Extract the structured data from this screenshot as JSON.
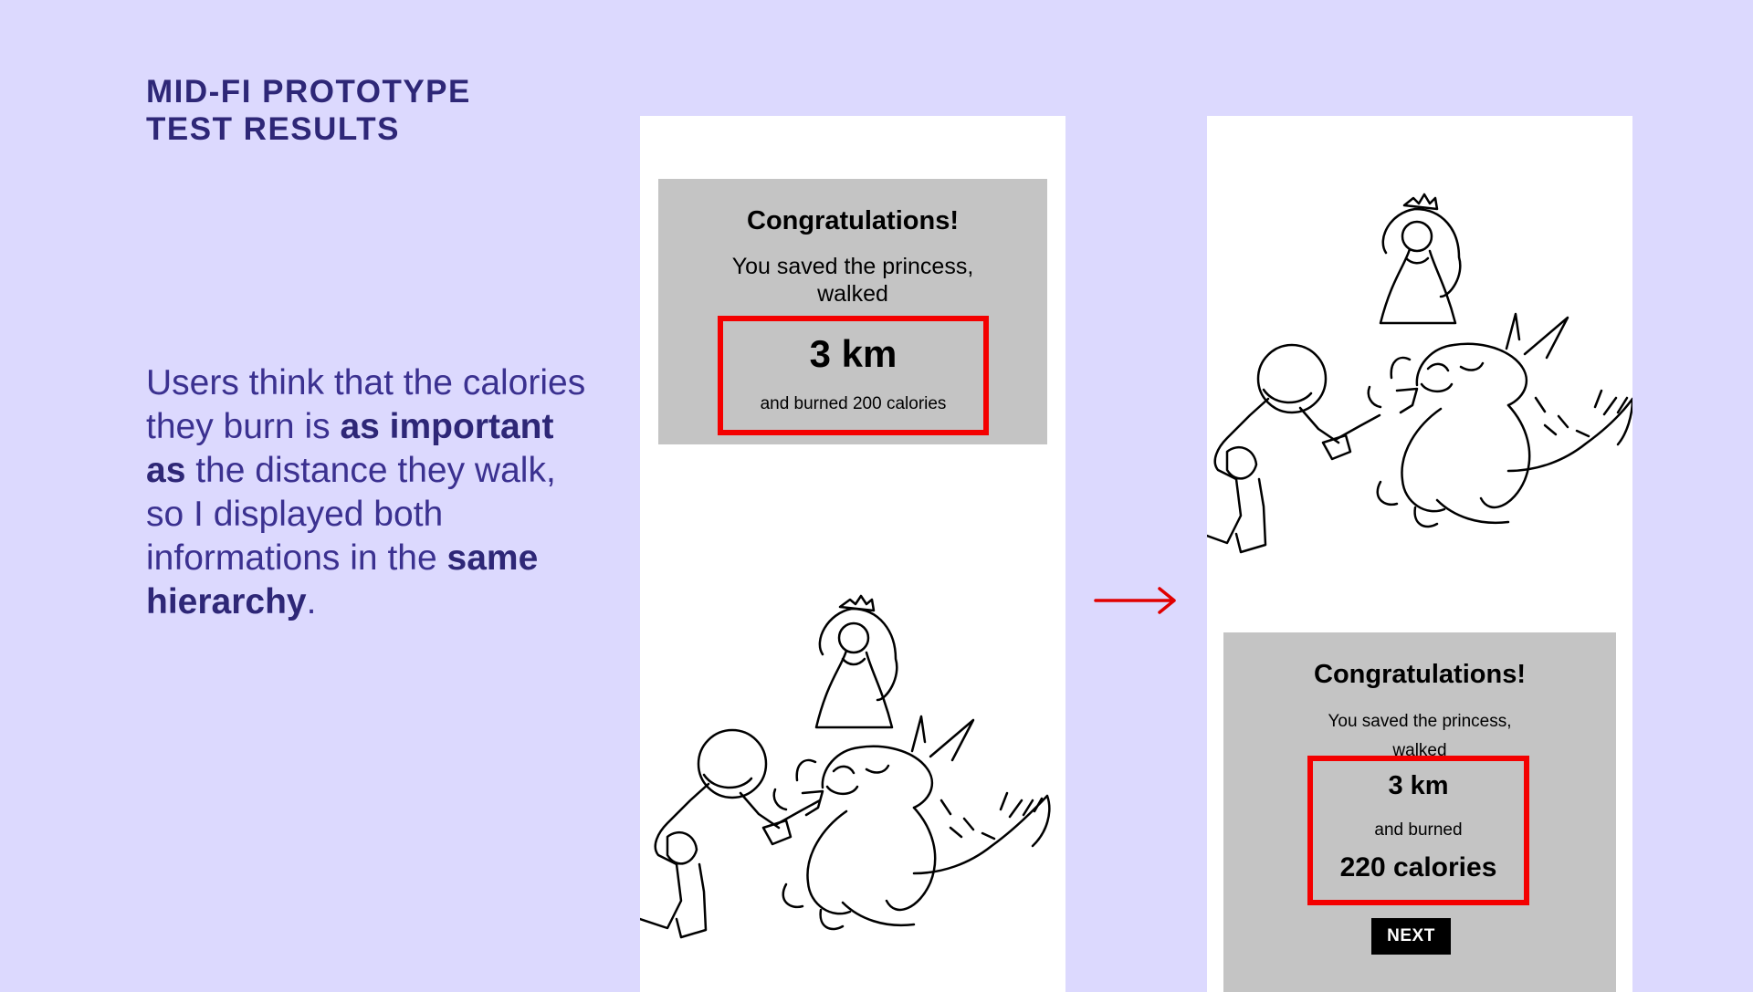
{
  "heading": {
    "line1": "MID-FI PROTOTYPE",
    "line2": "TEST RESULTS"
  },
  "description": {
    "t1": "Users think that the calories they burn is ",
    "b1": "as important as",
    "t2": " the distance they walk, so I displayed both informations in the ",
    "b2": "same hierarchy",
    "t3": "."
  },
  "before": {
    "congrats": "Congratulations!",
    "subtext": "You saved the princess, walked",
    "distance": "3 km",
    "calories_text": "and burned 200 calories"
  },
  "after": {
    "congrats": "Congratulations!",
    "subtext": "You saved the princess, walked",
    "distance": "3 km",
    "burned": "and burned",
    "calories": "220 calories",
    "next_label": "NEXT"
  },
  "colors": {
    "background": "#dcd9fe",
    "heading": "#2e2777",
    "highlight": "#f40000",
    "card": "#c4c4c4"
  },
  "icons": [
    "princess-illustration",
    "knight-illustration",
    "dragon-illustration",
    "right-arrow-icon"
  ]
}
